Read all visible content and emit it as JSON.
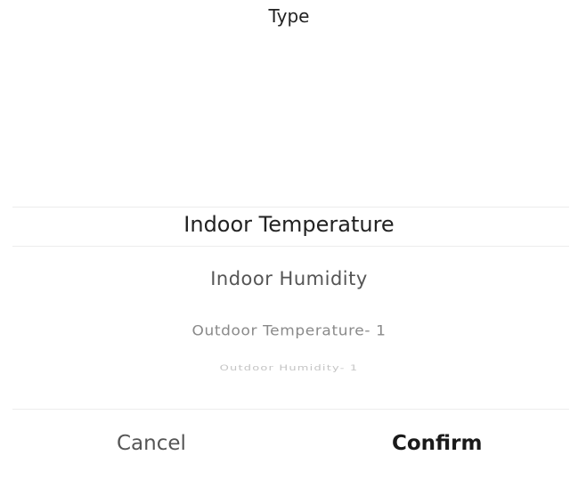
{
  "dialog": {
    "title": "Type"
  },
  "picker": {
    "options": [
      "Indoor Temperature",
      "Indoor Humidity",
      "Outdoor Temperature- 1",
      "Outdoor Humidity- 1"
    ],
    "selected": "Indoor Temperature"
  },
  "actions": {
    "cancel_label": "Cancel",
    "confirm_label": "Confirm"
  }
}
